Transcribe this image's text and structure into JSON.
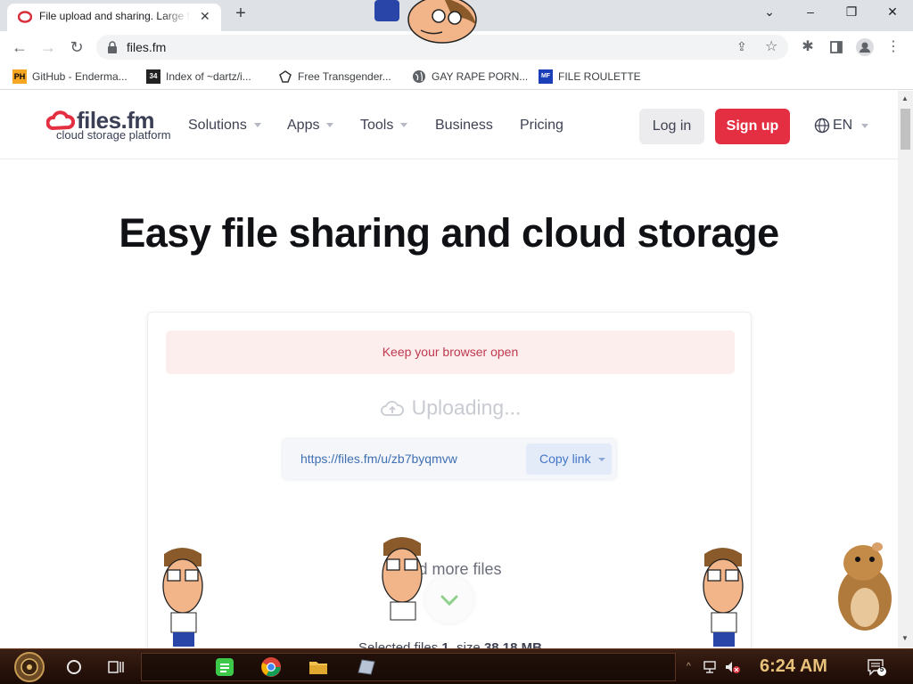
{
  "browser": {
    "tab_title": "File upload and sharing. Large f",
    "new_tab": "+",
    "address": "files.fm",
    "window_controls": {
      "minimize": "–",
      "restore": "❐",
      "close": "✕",
      "tab_search": "⌄"
    }
  },
  "bookmarks": [
    {
      "label": "GitHub - Enderma...",
      "icon": "PH"
    },
    {
      "label": "Index of ~dartz/i...",
      "icon": "34"
    },
    {
      "label": "Free Transgender...",
      "icon": ""
    },
    {
      "label": "GAY RAPE PORN...",
      "icon": ""
    },
    {
      "label": "FILE ROULETTE",
      "icon": "MF"
    }
  ],
  "site": {
    "logo": {
      "brand": "files.fm",
      "tagline": "cloud storage platform"
    },
    "nav": [
      {
        "label": "Solutions",
        "dropdown": true
      },
      {
        "label": "Apps",
        "dropdown": true
      },
      {
        "label": "Tools",
        "dropdown": true
      },
      {
        "label": "Business",
        "dropdown": false
      },
      {
        "label": "Pricing",
        "dropdown": false
      }
    ],
    "login": "Log in",
    "signup": "Sign up",
    "language": "EN"
  },
  "hero": {
    "title": "Easy file sharing and cloud storage"
  },
  "upload": {
    "alert": "Keep your browser open",
    "status": "Uploading...",
    "share_url": "https://files.fm/u/zb7byqmvw",
    "copy_link": "Copy link",
    "add_more": "Add more files",
    "selected_prefix": "Selected files ",
    "selected_count": "1",
    "selected_mid": ", size ",
    "selected_size": "38.18 MB"
  },
  "taskbar": {
    "time": "6:24 AM",
    "notifications": "5"
  },
  "colors": {
    "brand_red": "#e42e42",
    "link_blue": "#3f6fb2",
    "alert_bg": "#fdeeee",
    "clock": "#e8c27a"
  }
}
